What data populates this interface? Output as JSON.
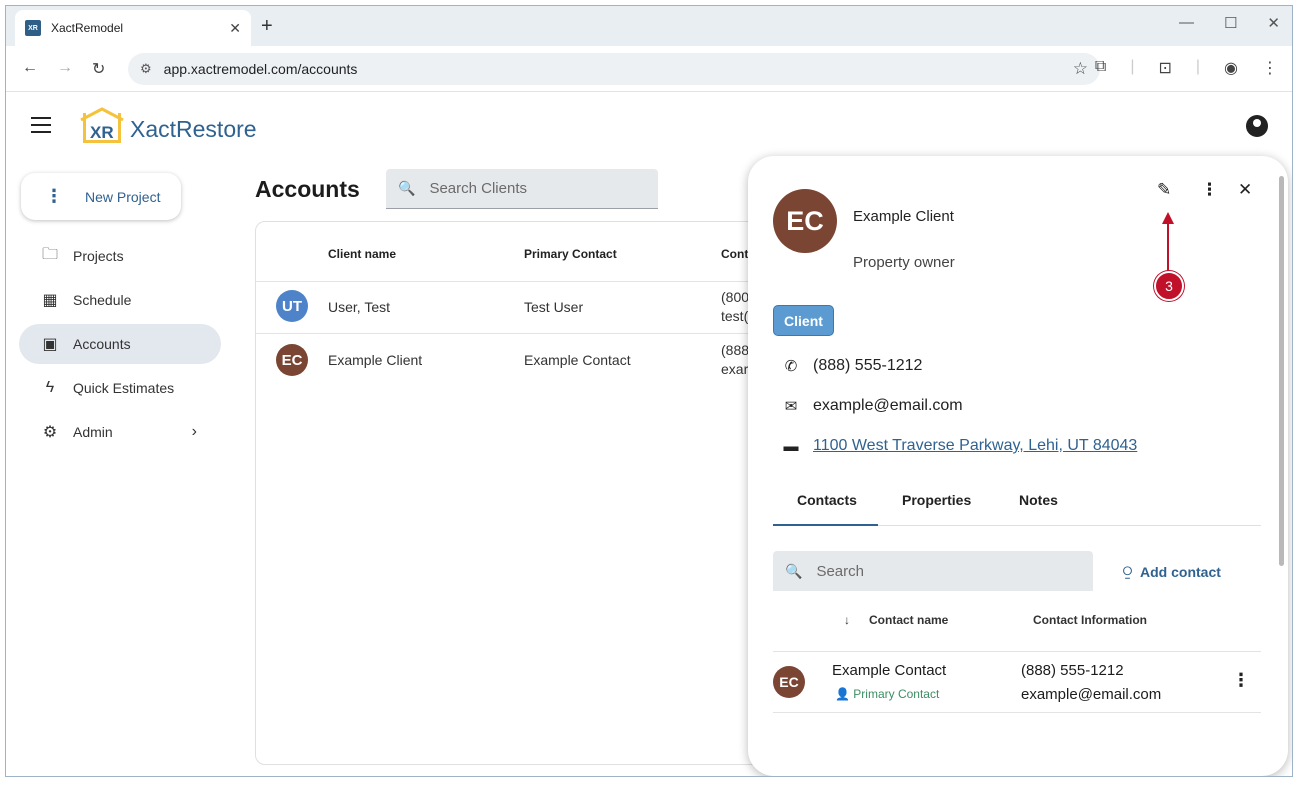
{
  "browser": {
    "tab_title": "XactRemodel",
    "tab_favicon": "XR",
    "new_tab": "+",
    "url": "app.xactremodel.com/accounts"
  },
  "app": {
    "logo_mark": "XR",
    "name": "XactRestore"
  },
  "sidebar": {
    "new_project": "New Project",
    "items": [
      {
        "label": "Projects",
        "icon": "folder-icon"
      },
      {
        "label": "Schedule",
        "icon": "calendar-icon"
      },
      {
        "label": "Accounts",
        "icon": "contact-card-icon"
      },
      {
        "label": "Quick Estimates",
        "icon": "lightning-icon"
      },
      {
        "label": "Admin",
        "icon": "gear-icon"
      }
    ]
  },
  "main": {
    "title": "Accounts",
    "search_placeholder": "Search Clients",
    "table": {
      "headers": [
        "Client name",
        "Primary Contact",
        "Cont"
      ],
      "rows": [
        {
          "initials": "UT",
          "name": "User, Test",
          "primary": "Test User",
          "contact_1": "(800",
          "contact_2": "test("
        },
        {
          "initials": "EC",
          "name": "Example Client",
          "primary": "Example Contact",
          "contact_1": "(888",
          "contact_2": "exar"
        }
      ]
    }
  },
  "drawer": {
    "initials": "EC",
    "name": "Example Client",
    "role": "Property owner",
    "badge": "Client",
    "phone": "(888) 555-1212",
    "email": "example@email.com",
    "address": "1100 West Traverse Parkway, Lehi, UT 84043",
    "tabs": [
      "Contacts",
      "Properties",
      "Notes"
    ],
    "search_placeholder": "Search",
    "add_contact": "Add contact",
    "contact_headers": [
      "Contact name",
      "Contact Information"
    ],
    "contact": {
      "initials": "EC",
      "name": "Example Contact",
      "tag": "Primary Contact",
      "phone": "(888) 555-1212",
      "email": "example@email.com"
    }
  },
  "annotation": {
    "step": "3"
  }
}
